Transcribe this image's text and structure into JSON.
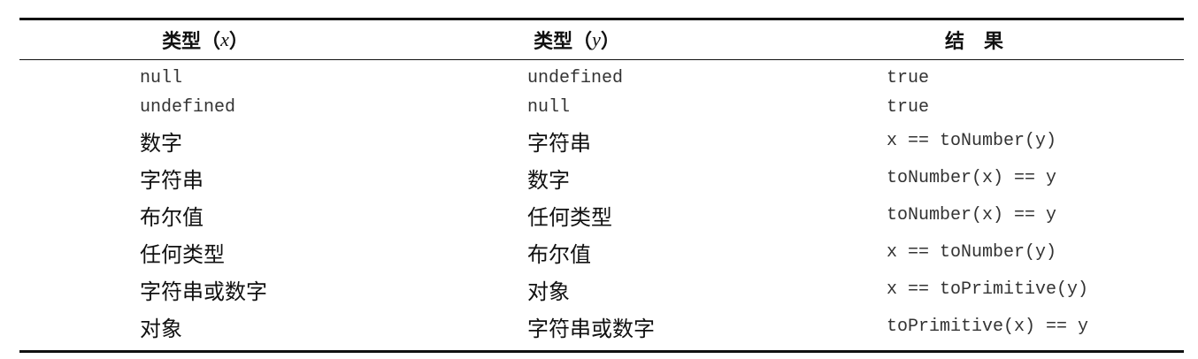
{
  "header": {
    "col1_prefix": "类型（",
    "col1_var": "x",
    "col1_suffix": "）",
    "col2_prefix": "类型（",
    "col2_var": "y",
    "col2_suffix": "）",
    "col3": "结果"
  },
  "rows": [
    {
      "x": "null",
      "y": "undefined",
      "result": "true"
    },
    {
      "x": "undefined",
      "y": "null",
      "result": "true"
    },
    {
      "x": "数字",
      "y": "字符串",
      "result": "x == toNumber(y)"
    },
    {
      "x": "字符串",
      "y": "数字",
      "result": "toNumber(x) == y"
    },
    {
      "x": "布尔值",
      "y": "任何类型",
      "result": "toNumber(x) == y"
    },
    {
      "x": "任何类型",
      "y": "布尔值",
      "result": "x == toNumber(y)"
    },
    {
      "x": "字符串或数字",
      "y": "对象",
      "result": "x == toPrimitive(y)"
    },
    {
      "x": "对象",
      "y": "字符串或数字",
      "result": "toPrimitive(x) == y"
    }
  ]
}
